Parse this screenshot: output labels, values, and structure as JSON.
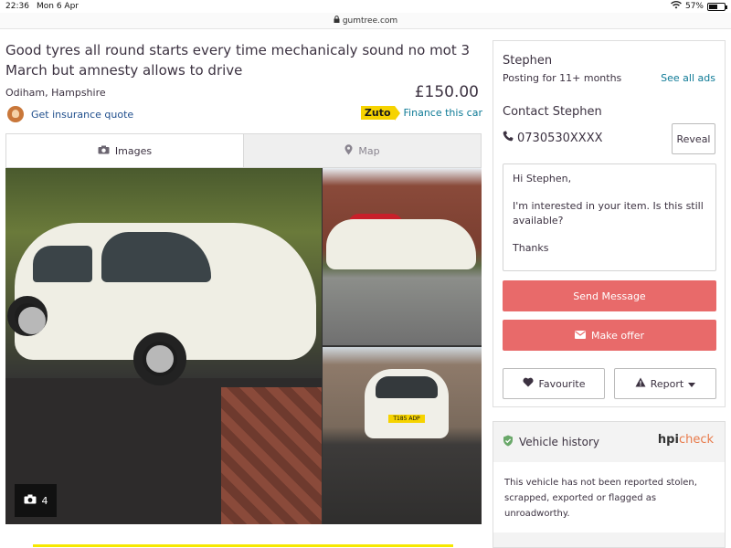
{
  "status_bar": {
    "time": "22:36",
    "date": "Mon 6 Apr",
    "battery": "57%",
    "battery_level": 0.57
  },
  "browser": {
    "url": "gumtree.com"
  },
  "listing": {
    "title": "Good tyres all round starts every time mechanicaly sound no mot 3 March but amnesty allows to drive",
    "location": "Odiham, Hampshire",
    "price": "£150.00",
    "insurance_link": "Get insurance quote",
    "finance_brand": "Zuto",
    "finance_link": "Finance this car"
  },
  "gallery": {
    "tabs": [
      {
        "label": "Images",
        "icon": "camera-icon",
        "active": true
      },
      {
        "label": "Map",
        "icon": "map-pin-icon",
        "active": false
      }
    ],
    "photo_count": "4",
    "plate_text": "T185 ADP"
  },
  "seller": {
    "name": "Stephen",
    "posting_duration": "Posting for 11+ months",
    "see_all_label": "See all ads",
    "contact_heading": "Contact Stephen",
    "phone": "0730530XXXX",
    "reveal_label": "Reveal",
    "message": {
      "greeting": "Hi Stephen,",
      "body": "I'm interested in your item. Is this still available?",
      "signoff": "Thanks"
    },
    "send_label": "Send Message",
    "offer_label": "Make offer",
    "favourite_label": "Favourite",
    "report_label": "Report"
  },
  "vehicle_history": {
    "title": "Vehicle history",
    "brand_hpi": "hpi",
    "brand_check": "check",
    "text": "This vehicle has not been reported stolen, scrapped, exported or flagged as unroadworthy."
  },
  "colors": {
    "accent_button": "#e86a6a",
    "link": "#0e7a96",
    "zuto_yellow": "#f6d300"
  }
}
